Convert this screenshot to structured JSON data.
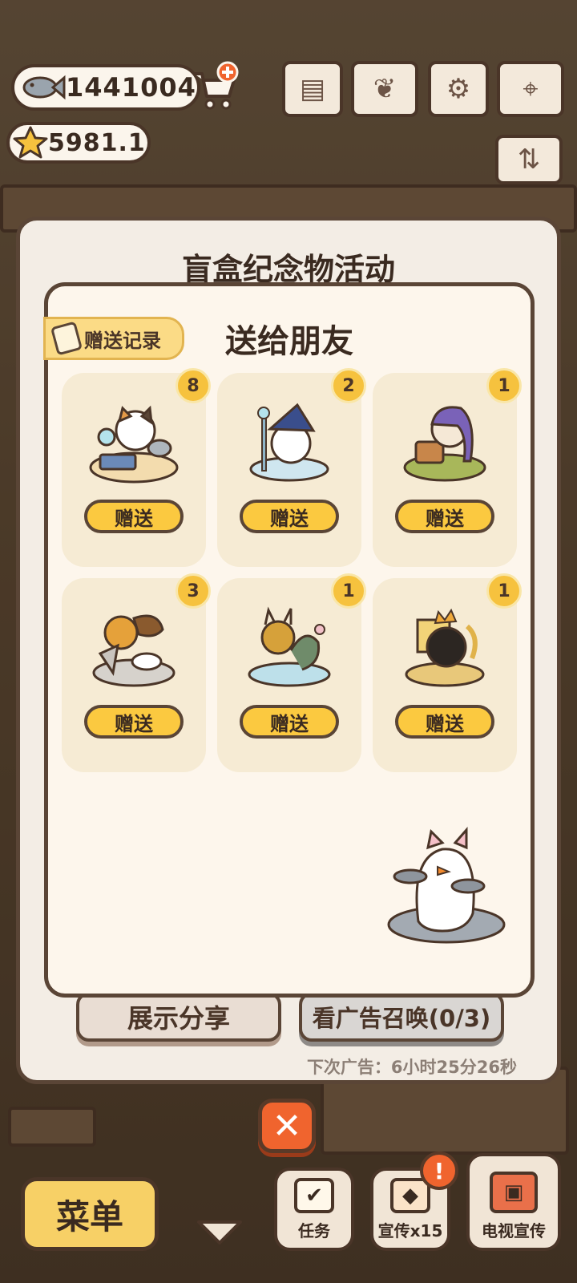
{
  "currency": {
    "fish": "1441004",
    "stars": "5981.1"
  },
  "outer_panel": {
    "title": "盲盒纪念物活动",
    "share_label": "展示分享",
    "ad_label": "看广告召唤(0/3)",
    "next_ad": "下次广告：6小时25分26秒"
  },
  "popup": {
    "title": "送给朋友",
    "record_label": "赠送记录",
    "items": [
      {
        "count": "8",
        "button": "赠送",
        "art": "calico-cat-alchemist"
      },
      {
        "count": "2",
        "button": "赠送",
        "art": "wizard-cat"
      },
      {
        "count": "1",
        "button": "赠送",
        "art": "purple-hair-treasure-cat"
      },
      {
        "count": "3",
        "button": "赠送",
        "art": "lion-warrior-cat"
      },
      {
        "count": "1",
        "button": "赠送",
        "art": "dragon-cat"
      },
      {
        "count": "1",
        "button": "赠送",
        "art": "black-king-cat"
      }
    ]
  },
  "bottom_bar": {
    "menu_label": "菜单",
    "task_label": "任务",
    "promo_label": "宣传x15",
    "tv_label": "电视宣传"
  },
  "colors": {
    "accent": "#fbc940",
    "close": "#f0642e",
    "outline": "#5a4536"
  }
}
